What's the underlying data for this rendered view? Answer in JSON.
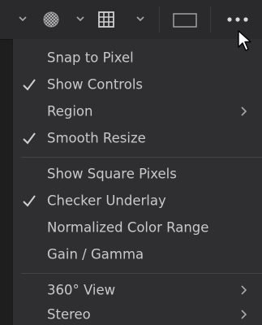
{
  "toolbar": {
    "icons": [
      "chevron-down-icon",
      "checker-icon",
      "chevron-down-icon",
      "grid-icon",
      "chevron-down-icon",
      "rectangle-icon",
      "more-icon"
    ]
  },
  "menu": {
    "groups": [
      {
        "items": [
          {
            "label": "Snap to Pixel",
            "checked": false,
            "submenu": false
          },
          {
            "label": "Show Controls",
            "checked": true,
            "submenu": false
          },
          {
            "label": "Region",
            "checked": false,
            "submenu": true
          },
          {
            "label": "Smooth Resize",
            "checked": true,
            "submenu": false
          }
        ]
      },
      {
        "items": [
          {
            "label": "Show Square Pixels",
            "checked": false,
            "submenu": false
          },
          {
            "label": "Checker Underlay",
            "checked": true,
            "submenu": false
          },
          {
            "label": "Normalized Color Range",
            "checked": false,
            "submenu": false
          },
          {
            "label": "Gain / Gamma",
            "checked": false,
            "submenu": false
          }
        ]
      },
      {
        "items": [
          {
            "label": "360° View",
            "checked": false,
            "submenu": true
          },
          {
            "label": "Stereo",
            "checked": false,
            "submenu": true
          }
        ]
      }
    ]
  },
  "colors": {
    "menu_bg": "#2f2f32",
    "text": "#c9c9c9",
    "toolbar_bg": "#2a2a2c"
  }
}
